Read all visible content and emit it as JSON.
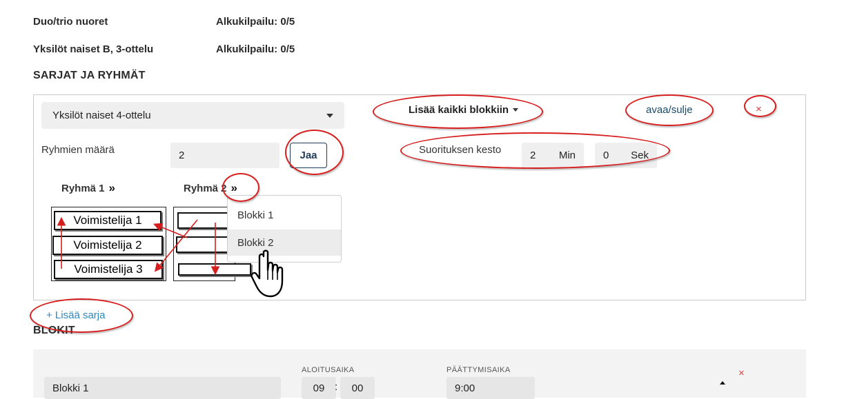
{
  "competitions": [
    {
      "name": "Duo/trio nuoret",
      "status": "Alkukilpailu: 0/5"
    },
    {
      "name": "Yksilöt naiset B, 3-ottelu",
      "status": "Alkukilpailu: 0/5"
    }
  ],
  "sarjat": {
    "section_title": "SARJAT JA RYHMÄT",
    "series_select": "Yksilöt naiset 4-ottelu",
    "add_all_to_blocks": "Lisää kaikki blokkiin",
    "toggle_label": "avaa/sulje",
    "remove_label": "×",
    "group_count_label": "Ryhmien määrä",
    "group_count_value": "2",
    "split_button": "Jaa",
    "duration_label": "Suorituksen kesto",
    "duration_min_value": "2",
    "duration_min_unit": "Min",
    "duration_sec_value": "0",
    "duration_sec_unit": "Sek",
    "groups": [
      {
        "title": "Ryhmä 1",
        "members": [
          "Voimistelija 1",
          "Voimistelija  2",
          "Voimistelija 3"
        ]
      },
      {
        "title": "Ryhmä 2",
        "members": [
          "",
          "",
          ""
        ]
      }
    ],
    "block_menu": [
      "Blokki 1",
      "Blokki 2"
    ],
    "chevron_glyph": "»",
    "add_series": "+ Lisää sarja"
  },
  "blokit": {
    "section_title": "BLOKIT",
    "start_header": "ALOITUSAIKA",
    "end_header": "PÄÄTTYMISAIKA",
    "block_name": "Blokki 1",
    "start_hours": "09",
    "start_sep": ":",
    "start_minutes": "00",
    "end_time": "9:00",
    "remove_label": "×"
  },
  "colors": {
    "annotation": "#d61e1e",
    "link": "#1a5f8a",
    "remove": "#e0393e"
  }
}
